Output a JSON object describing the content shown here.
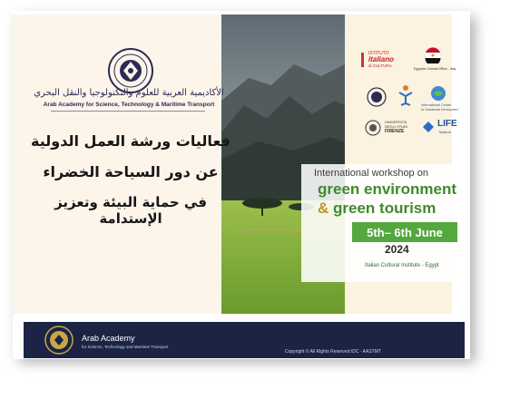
{
  "academy": {
    "name_ar": "الأكاديمية العربية للعلوم والتكنولوجيا والنقل البحري",
    "name_en": "Arab Academy for Science, Technology & Maritime Transport"
  },
  "arabic_title": {
    "line1": "فعاليات ورشة العمل الدولية",
    "line2": "عن دور السياحة الخضراء",
    "line3": "في حماية البيئة وتعزيز الإستدامة"
  },
  "partners": {
    "istituto": {
      "name": "ISTITUTO",
      "name2": "italiano",
      "name3": "di CULTURA"
    },
    "egypt_office": "Egyptian Cultural Office - Italy",
    "firenze": {
      "name": "UNIVERSITÀ",
      "name2": "DEGLI STUDI",
      "name3": "FIRENZE"
    },
    "intl_center": {
      "name": "International Center",
      "sub": "for Sustainable Development"
    },
    "life": {
      "name": "LIFE",
      "sub": "Makers"
    }
  },
  "workshop": {
    "title": "International workshop on",
    "green_line1": "green environment",
    "amp": "&",
    "green_line2": "green tourism",
    "date": "5th– 6th June",
    "year": "2024",
    "venue": "Italian Cultural Institute - Egypt"
  },
  "footer": {
    "name": "Arab Academy",
    "sub": "for Science, Technology and Maritime Transport",
    "copyright": "Copyright © All Rights Reserved IDC - AASTMT"
  },
  "colors": {
    "cream": "#fdf5ea",
    "navy": "#1b2444",
    "green": "#54a83d",
    "gold": "#c4912a"
  }
}
